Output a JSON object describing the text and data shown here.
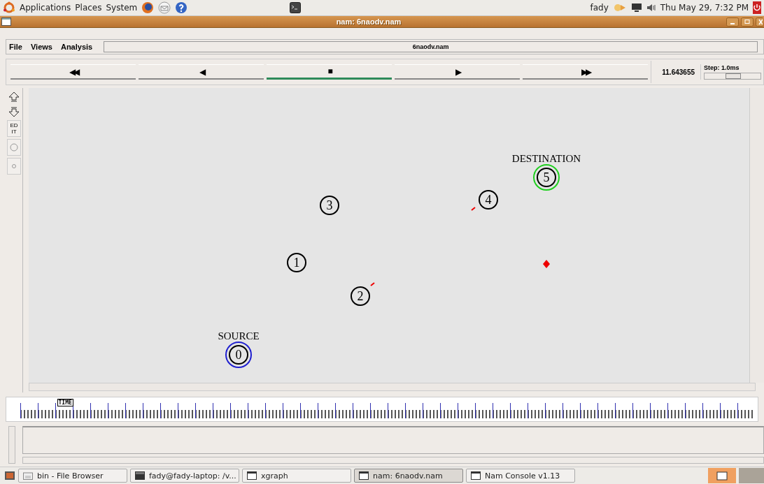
{
  "top_panel": {
    "menus": [
      "Applications",
      "Places",
      "System"
    ],
    "user": "fady",
    "clock": "Thu May 29,  7:32 PM"
  },
  "window": {
    "title": "nam: 6naodv.nam"
  },
  "menubar": {
    "items": [
      "File",
      "Views",
      "Analysis"
    ],
    "file_name": "6naodv.nam"
  },
  "controls": [
    {
      "label": "◀◀",
      "selected": false
    },
    {
      "label": "◀",
      "selected": false
    },
    {
      "label": "■",
      "selected": true
    },
    {
      "label": "▶",
      "selected": false
    },
    {
      "label": "▶▶",
      "selected": false
    }
  ],
  "time_display": "11.643655",
  "step": {
    "label": "Step: 1.0ms",
    "level": 0.5
  },
  "tools": [
    {
      "kind": "up"
    },
    {
      "kind": "down"
    },
    {
      "kind": "text",
      "label": "ED IT"
    },
    {
      "kind": "circle"
    },
    {
      "kind": "dot"
    }
  ],
  "nodes": [
    {
      "label": "0",
      "caption": "SOURCE",
      "color": "#2020d0"
    },
    {
      "label": "1"
    },
    {
      "label": "2"
    },
    {
      "label": "3"
    },
    {
      "label": "4"
    },
    {
      "label": "5",
      "caption": "DESTINATION",
      "color": "#20d020"
    }
  ],
  "timeline": {
    "marker": "TIME",
    "level": 0.05
  },
  "taskbar": [
    {
      "label": "bin - File Browser",
      "kind": "folder",
      "selected": false
    },
    {
      "label": "fady@fady-laptop: /v...",
      "kind": "terminal",
      "selected": false
    },
    {
      "label": "xgraph",
      "kind": "window",
      "selected": false
    },
    {
      "label": "nam: 6naodv.nam",
      "kind": "window",
      "selected": true
    },
    {
      "label": "Nam Console v1.13",
      "kind": "window",
      "selected": false
    }
  ]
}
